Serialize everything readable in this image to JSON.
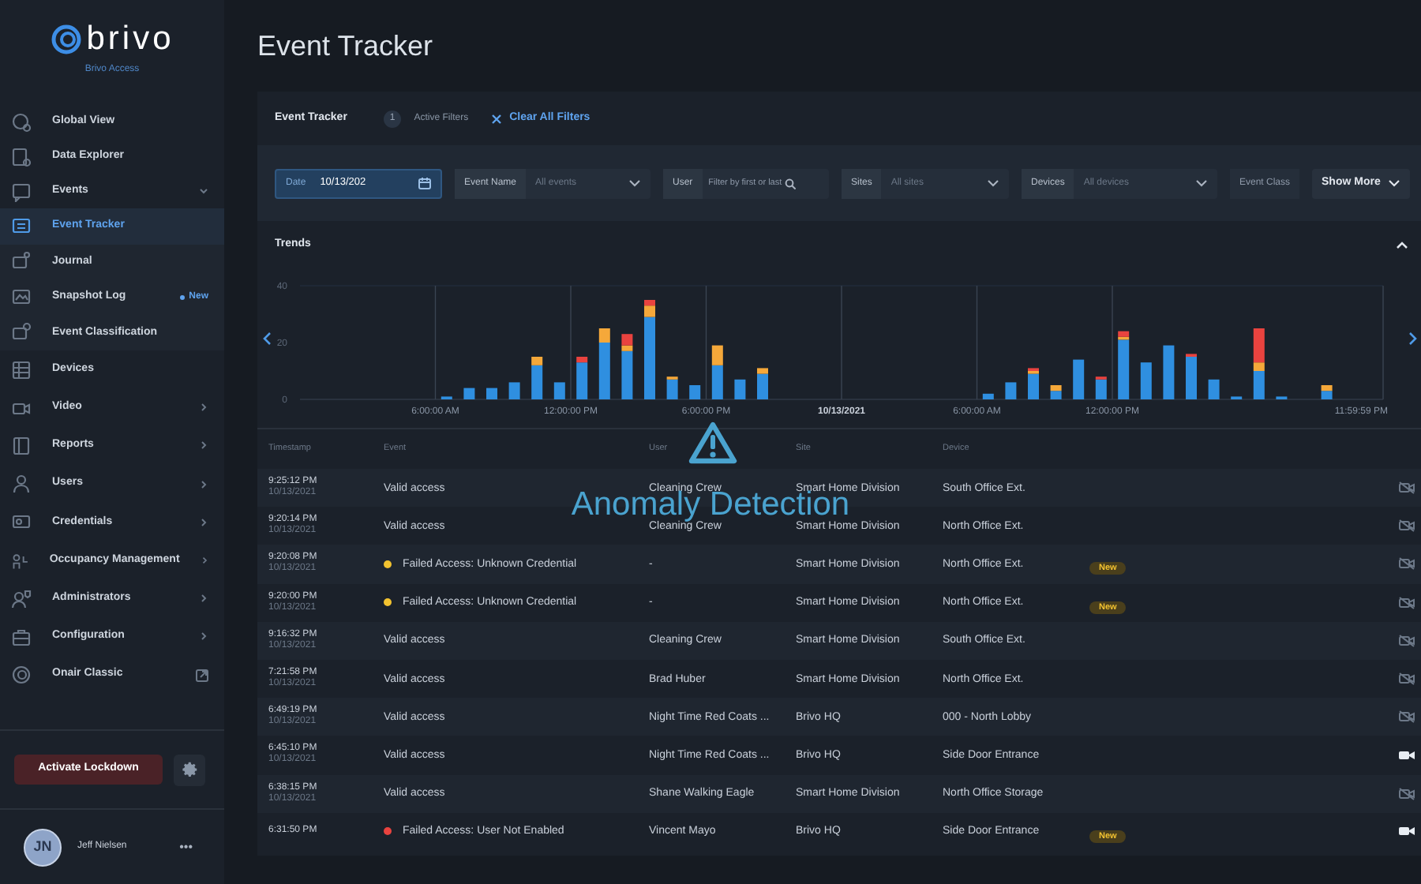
{
  "brand": {
    "name": "brivo",
    "subtitle": "Brivo Access"
  },
  "sidebar": {
    "items": [
      {
        "label": "Global View",
        "kind": "link",
        "selected": false
      },
      {
        "label": "Data Explorer",
        "kind": "link",
        "selected": false
      },
      {
        "label": "Events",
        "kind": "group",
        "expanded": true,
        "selected": false,
        "children": [
          {
            "label": "Event Tracker",
            "selected": true
          },
          {
            "label": "Journal",
            "selected": false
          },
          {
            "label": "Snapshot Log",
            "selected": false,
            "badge": "New"
          },
          {
            "label": "Event Classification",
            "selected": false
          }
        ]
      },
      {
        "label": "Devices",
        "kind": "link",
        "selected": false
      },
      {
        "label": "Video",
        "kind": "group",
        "expanded": false,
        "selected": false
      },
      {
        "label": "Reports",
        "kind": "group",
        "expanded": false,
        "selected": false
      },
      {
        "label": "Users",
        "kind": "group",
        "expanded": false,
        "selected": false
      },
      {
        "label": "Credentials",
        "kind": "group",
        "expanded": false,
        "selected": false
      },
      {
        "label": "Occupancy Management",
        "kind": "group",
        "expanded": false,
        "selected": false
      },
      {
        "label": "Administrators",
        "kind": "group",
        "expanded": false,
        "selected": false
      },
      {
        "label": "Configuration",
        "kind": "group",
        "expanded": false,
        "selected": false
      },
      {
        "label": "Onair Classic",
        "kind": "external",
        "selected": false
      }
    ],
    "lockdown_button": "Activate Lockdown",
    "user": {
      "initials": "JN",
      "name": "Jeff Nielsen",
      "menu": "•••"
    }
  },
  "page_title": "Event Tracker",
  "card": {
    "title": "Event Tracker",
    "active_filter_count": "1",
    "active_filters_label": "Active Filters",
    "clear_filters": "Clear All Filters",
    "filters": [
      {
        "kind": "date",
        "label": "Date",
        "value": "10/13/202"
      },
      {
        "kind": "select",
        "label": "Event Name",
        "placeholder": "All events"
      },
      {
        "kind": "search",
        "label": "User",
        "placeholder": "Filter by first or last"
      },
      {
        "kind": "select",
        "label": "Sites",
        "placeholder": "All sites"
      },
      {
        "kind": "select",
        "label": "Devices",
        "placeholder": "All devices"
      },
      {
        "kind": "partial",
        "label": "Event Class"
      }
    ],
    "show_more": "Show More",
    "trends": {
      "title": "Trends",
      "expanded": true,
      "chart_data": {
        "type": "bar",
        "stacked": true,
        "grid": true,
        "x": [
          "2021-10-12T06:30:00",
          "2021-10-12T07:30:00",
          "2021-10-12T08:30:00",
          "2021-10-12T09:30:00",
          "2021-10-12T10:30:00",
          "2021-10-12T11:30:00",
          "2021-10-12T12:30:00",
          "2021-10-12T13:30:00",
          "2021-10-12T14:30:00",
          "2021-10-12T15:30:00",
          "2021-10-12T16:30:00",
          "2021-10-12T17:30:00",
          "2021-10-12T18:30:00",
          "2021-10-12T19:30:00",
          "2021-10-12T20:30:00",
          "2021-10-13T06:30:00",
          "2021-10-13T07:30:00",
          "2021-10-13T08:30:00",
          "2021-10-13T09:30:00",
          "2021-10-13T10:30:00",
          "2021-10-13T11:30:00",
          "2021-10-13T12:30:00",
          "2021-10-13T13:30:00",
          "2021-10-13T14:30:00",
          "2021-10-13T15:30:00",
          "2021-10-13T16:30:00",
          "2021-10-13T17:30:00",
          "2021-10-13T18:30:00",
          "2021-10-13T19:30:00",
          "2021-10-13T21:30:00"
        ],
        "series": [
          {
            "color": "#2f8fe0",
            "values": [
              1,
              4,
              4,
              6,
              12,
              6,
              13,
              20,
              17,
              29,
              7,
              5,
              12,
              7,
              9,
              2,
              6,
              9,
              3,
              14,
              7,
              21,
              13,
              19,
              15,
              7,
              1,
              10,
              1,
              3
            ]
          },
          {
            "color": "#f5a83a",
            "values": [
              0,
              0,
              0,
              0,
              3,
              0,
              0,
              5,
              2,
              4,
              1,
              0,
              7,
              0,
              2,
              0,
              0,
              1,
              2,
              0,
              0,
              1,
              0,
              0,
              0,
              0,
              0,
              3,
              0,
              2
            ]
          },
          {
            "color": "#e9433f",
            "values": [
              0,
              0,
              0,
              0,
              0,
              0,
              2,
              0,
              4,
              2,
              0,
              0,
              0,
              0,
              0,
              0,
              0,
              1,
              0,
              0,
              1,
              2,
              0,
              0,
              1,
              0,
              0,
              12,
              0,
              0
            ]
          }
        ],
        "xlim": [
          "2021-10-12T00:00:00",
          "2021-10-14T00:00:00"
        ],
        "ylim": [
          0,
          40
        ],
        "yticks": [
          0,
          20,
          40
        ],
        "xticks": [
          {
            "value": "2021-10-12T06:00:00",
            "label": "6:00:00 AM"
          },
          {
            "value": "2021-10-12T12:00:00",
            "label": "12:00:00 PM"
          },
          {
            "value": "2021-10-12T18:00:00",
            "label": "6:00:00 PM"
          },
          {
            "value": "2021-10-13T00:00:00",
            "label": "10/13/2021"
          },
          {
            "value": "2021-10-13T06:00:00",
            "label": "6:00:00 AM"
          },
          {
            "value": "2021-10-13T12:00:00",
            "label": "12:00:00 PM"
          },
          {
            "value": "2021-10-13T23:59:59",
            "label": "11:59:59 PM"
          }
        ]
      }
    },
    "table": {
      "columns": [
        "Timestamp",
        "Event",
        "User",
        "Site",
        "Device"
      ],
      "rows": [
        {
          "time": "9:25:12 PM",
          "date": "10/13/2021",
          "event": "Valid access",
          "user": "Cleaning Crew",
          "site": "Smart Home Division",
          "device": "South Office Ext.",
          "video": false
        },
        {
          "time": "9:20:14 PM",
          "date": "10/13/2021",
          "event": "Valid access",
          "user": "Cleaning Crew",
          "site": "Smart Home Division",
          "device": "North Office Ext.",
          "video": false
        },
        {
          "time": "9:20:08 PM",
          "date": "10/13/2021",
          "event": "Failed Access: Unknown Credential",
          "color": "#f2c230",
          "user": "-",
          "site": "Smart Home Division",
          "device": "North Office Ext.",
          "badge": "New",
          "video": false
        },
        {
          "time": "9:20:00 PM",
          "date": "10/13/2021",
          "event": "Failed Access: Unknown Credential",
          "color": "#f2c230",
          "user": "-",
          "site": "Smart Home Division",
          "device": "North Office Ext.",
          "badge": "New",
          "video": false
        },
        {
          "time": "9:16:32 PM",
          "date": "10/13/2021",
          "event": "Valid access",
          "user": "Cleaning Crew",
          "site": "Smart Home Division",
          "device": "South Office Ext.",
          "video": false
        },
        {
          "time": "7:21:58 PM",
          "date": "10/13/2021",
          "event": "Valid access",
          "user": "Brad Huber",
          "site": "Smart Home Division",
          "device": "North Office Ext.",
          "video": false
        },
        {
          "time": "6:49:19 PM",
          "date": "10/13/2021",
          "event": "Valid access",
          "user": "Night Time Red Coats ...",
          "site": "Brivo HQ",
          "device": "000 - North Lobby",
          "video": false
        },
        {
          "time": "6:45:10 PM",
          "date": "10/13/2021",
          "event": "Valid access",
          "user": "Night Time Red Coats ...",
          "site": "Brivo HQ",
          "device": "Side Door Entrance",
          "video": true
        },
        {
          "time": "6:38:15 PM",
          "date": "10/13/2021",
          "event": "Valid access",
          "user": "Shane Walking Eagle",
          "site": "Smart Home Division",
          "device": "North Office Storage",
          "video": false
        },
        {
          "time": "6:31:50 PM",
          "event": "Failed Access: User Not Enabled",
          "color": "#e9433f",
          "user": "Vincent Mayo",
          "site": "Brivo HQ",
          "device": "Side Door Entrance",
          "badge": "New",
          "video": true
        }
      ]
    }
  },
  "overlay": {
    "text": "Anomaly Detection"
  }
}
